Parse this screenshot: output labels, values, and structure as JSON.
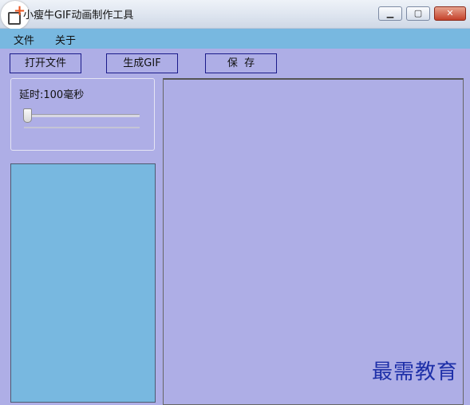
{
  "window": {
    "title": "小瘦牛GIF动画制作工具",
    "min_glyph": "▁",
    "max_glyph": "▢",
    "close_glyph": "✕"
  },
  "menu": {
    "items": [
      "文件",
      "关于"
    ]
  },
  "toolbar": {
    "open_label": "打开文件",
    "generate_label": "生成GIF",
    "save_label": "保  存"
  },
  "delay": {
    "label": "延时:100毫秒",
    "value_ms": 100,
    "slider_fraction": 0.0
  },
  "watermark": "最需教育",
  "colors": {
    "menubar": "#78b8e0",
    "background": "#aeaee6",
    "frame_list": "#78b8e0",
    "watermark": "#1d2fa8"
  }
}
